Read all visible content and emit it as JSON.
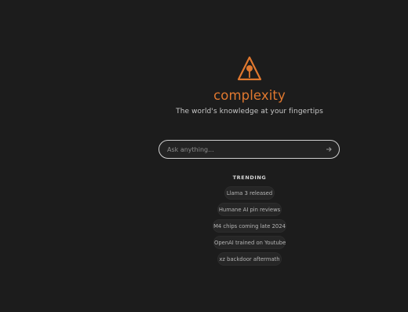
{
  "brand": {
    "name": "complexity",
    "tagline": "The world's knowledge at your fingertips",
    "accent_color": "#e0782f",
    "logo_icon": "warning-triangle-with-lollipop-icon"
  },
  "search": {
    "placeholder": "Ask anything...",
    "value": "",
    "submit_icon": "arrow-right-icon"
  },
  "trending": {
    "label": "TRENDING",
    "items": [
      {
        "label": "Llama 3 released"
      },
      {
        "label": "Humane AI pin reviews"
      },
      {
        "label": "M4 chips coming late 2024"
      },
      {
        "label": "OpenAI trained on Youtube"
      },
      {
        "label": "xz backdoor aftermath"
      }
    ]
  }
}
